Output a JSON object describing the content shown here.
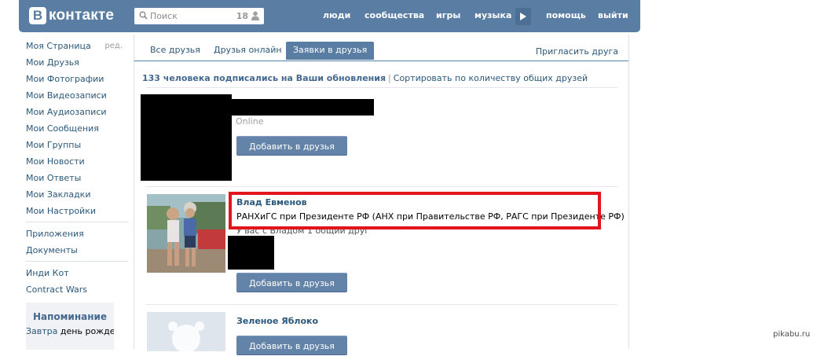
{
  "header": {
    "logo_letter": "B",
    "logo_text": "контакте",
    "search": {
      "placeholder": "Поиск",
      "count": "18"
    },
    "nav": [
      "люди",
      "сообщества",
      "игры",
      "музыка",
      "помощь",
      "выйти"
    ]
  },
  "sidebar": {
    "items": [
      "Моя Страница",
      "Мои Друзья",
      "Мои Фотографии",
      "Мои Видеозаписи",
      "Мои Аудиозаписи",
      "Мои Сообщения",
      "Мои Группы",
      "Мои Новости",
      "Мои Ответы",
      "Мои Закладки",
      "Мои Настройки"
    ],
    "edit_label": "ред.",
    "apps": [
      "Приложения",
      "Документы"
    ],
    "games": [
      "Инди Кот",
      "Contract Wars"
    ]
  },
  "reminder": {
    "title": "Напоминание",
    "text_link": "Завтра",
    "text_rest": "день рождения Кристины"
  },
  "tabs": {
    "items": [
      "Все друзья",
      "Друзья онлайн",
      "Заявки в друзья"
    ],
    "active": "Заявки в друзья",
    "invite": "Пригласить друга"
  },
  "summary": {
    "count_text": "133 человека подписались на Ваши обновления",
    "separator": "|",
    "sort_text": "Сортировать по количеству общих друзей"
  },
  "requests": [
    {
      "status": "Online",
      "add_label": "Добавить в друзья"
    },
    {
      "name": "Влад Евменов",
      "university": "РАНХиГС при Президенте РФ (АНХ при Правительстве РФ, РАГС при Президенте РФ)",
      "mutual": "У вас с Владом 1 общий друг",
      "add_label": "Добавить в друзья"
    },
    {
      "name": "Зеленое Яблоко",
      "add_label": "Добавить в друзья"
    }
  ],
  "watermark": "pikabu.ru",
  "colors": {
    "header_bg": "#597da3",
    "link": "#2b587a",
    "button": "#6383a8",
    "highlight": "#e2141d"
  }
}
